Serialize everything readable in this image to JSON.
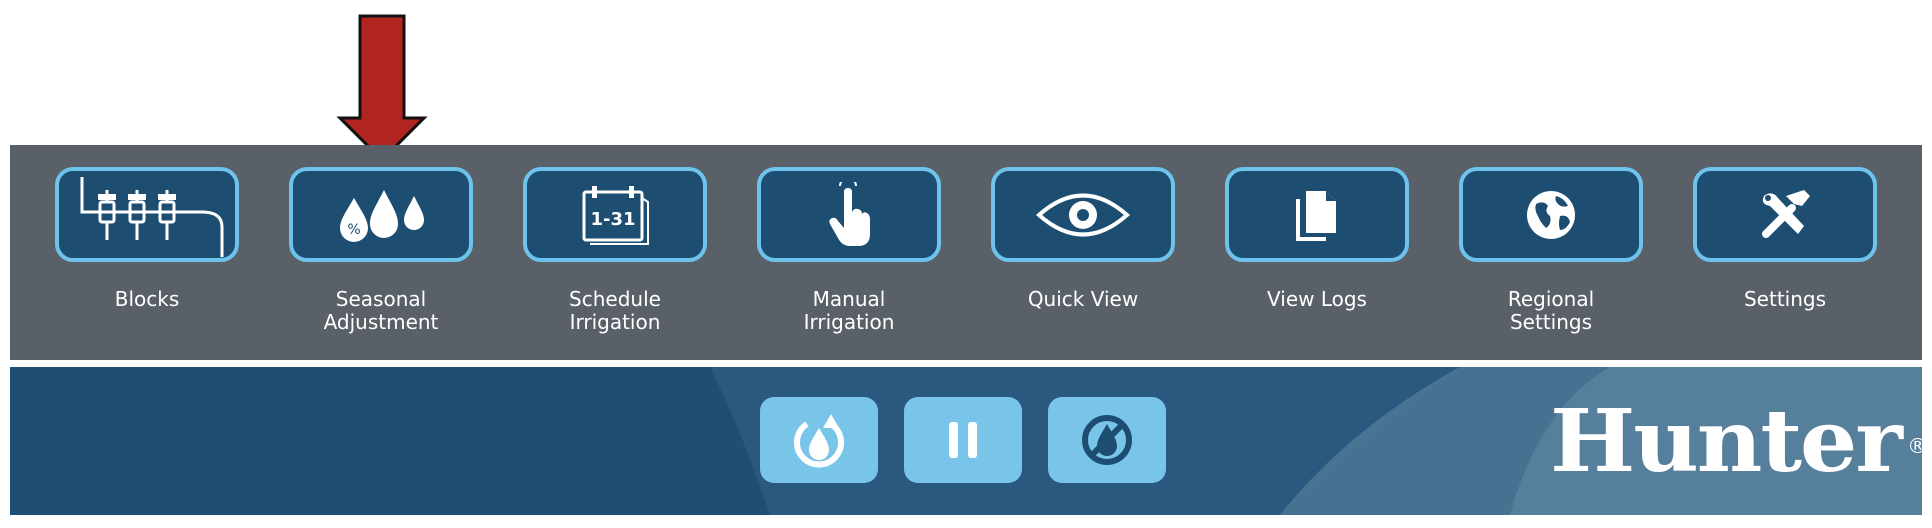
{
  "menu": {
    "items": [
      {
        "id": "blocks",
        "lines": [
          "Blocks",
          ""
        ],
        "icon": "sprinkler-blocks-icon"
      },
      {
        "id": "seasonal",
        "lines": [
          "Seasonal",
          "Adjustment"
        ],
        "icon": "water-drops-percent-icon",
        "icon_text": "%"
      },
      {
        "id": "schedule",
        "lines": [
          "Schedule",
          "Irrigation"
        ],
        "icon": "calendar-icon",
        "icon_text": "1-31"
      },
      {
        "id": "manual",
        "lines": [
          "Manual",
          "Irrigation"
        ],
        "icon": "touch-hand-icon"
      },
      {
        "id": "quickview",
        "lines": [
          "Quick View",
          ""
        ],
        "icon": "eye-icon"
      },
      {
        "id": "logs",
        "lines": [
          "View Logs",
          ""
        ],
        "icon": "documents-icon"
      },
      {
        "id": "regional",
        "lines": [
          "Regional",
          "Settings"
        ],
        "icon": "globe-icon"
      },
      {
        "id": "settings",
        "lines": [
          "Settings",
          ""
        ],
        "icon": "tools-icon"
      }
    ]
  },
  "controls": {
    "buttons": [
      {
        "id": "cycle",
        "icon": "water-cycle-icon"
      },
      {
        "id": "pause",
        "icon": "pause-icon"
      },
      {
        "id": "off",
        "icon": "rain-off-icon"
      }
    ]
  },
  "brand": {
    "logo": "Hunter",
    "registered": "®"
  },
  "colors": {
    "panel": "#5a6068",
    "button_fill": "#1d4e72",
    "button_border": "#6ec3ec",
    "bottom_bar": "#1f4e74",
    "control_button": "#79c5ea",
    "arrow": "#b22420"
  }
}
